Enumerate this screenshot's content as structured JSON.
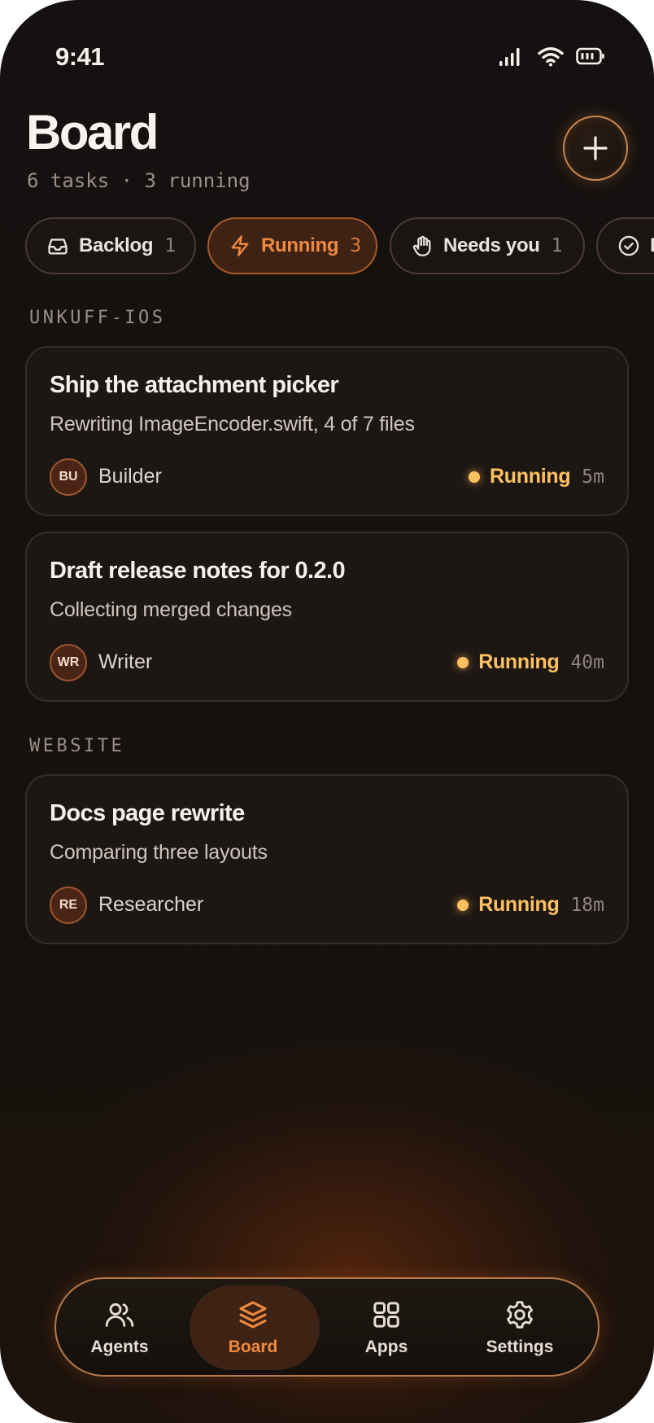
{
  "status_bar": {
    "time": "9:41"
  },
  "header": {
    "title": "Board",
    "subtitle": "6 tasks · 3 running"
  },
  "filters": [
    {
      "label": "Backlog",
      "count": "1",
      "icon": "inbox-icon",
      "active": false
    },
    {
      "label": "Running",
      "count": "3",
      "icon": "lightning-icon",
      "active": true
    },
    {
      "label": "Needs you",
      "count": "1",
      "icon": "hand-icon",
      "active": false
    },
    {
      "label": "D",
      "count": "",
      "icon": "check-circle-icon",
      "active": false
    }
  ],
  "sections": [
    {
      "label": "UNKUFF-IOS",
      "cards": [
        {
          "title": "Ship the attachment picker",
          "description": "Rewriting ImageEncoder.swift, 4 of 7 files",
          "avatar": "BU",
          "agent": "Builder",
          "status": "Running",
          "elapsed": "5m"
        },
        {
          "title": "Draft release notes for 0.2.0",
          "description": "Collecting merged changes",
          "avatar": "WR",
          "agent": "Writer",
          "status": "Running",
          "elapsed": "40m"
        }
      ]
    },
    {
      "label": "WEBSITE",
      "cards": [
        {
          "title": "Docs page rewrite",
          "description": "Comparing three layouts",
          "avatar": "RE",
          "agent": "Researcher",
          "status": "Running",
          "elapsed": "18m"
        }
      ]
    }
  ],
  "tab_bar": [
    {
      "label": "Agents",
      "icon": "people-icon",
      "active": false
    },
    {
      "label": "Board",
      "icon": "layers-icon",
      "active": true
    },
    {
      "label": "Apps",
      "icon": "grid-icon",
      "active": false
    },
    {
      "label": "Settings",
      "icon": "gear-icon",
      "active": false
    }
  ],
  "colors": {
    "accent": "#f08a3e",
    "running": "#ffc061",
    "background": "#141110"
  }
}
